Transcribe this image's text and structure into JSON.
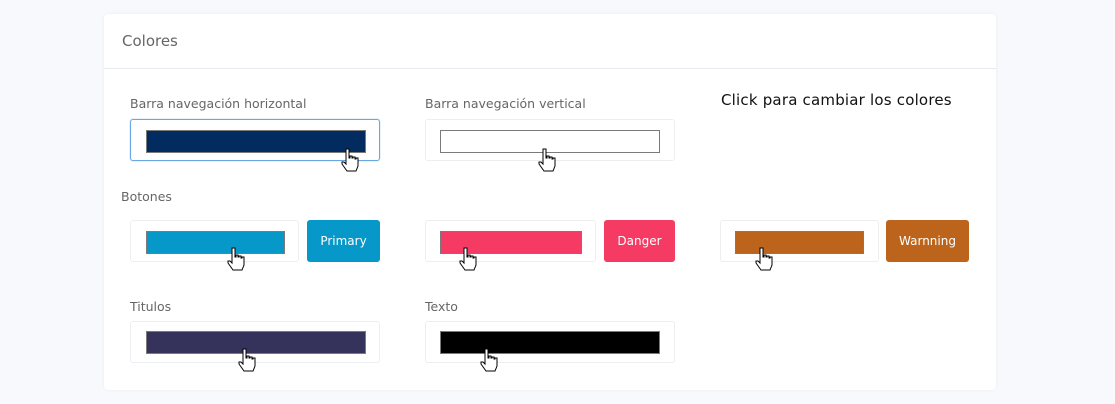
{
  "card": {
    "title": "Colores"
  },
  "hint": "Click para cambiar los colores",
  "sections": {
    "navbar_horizontal": {
      "label": "Barra navegación horizontal",
      "color": "#022c5f"
    },
    "navbar_vertical": {
      "label": "Barra navegación vertical",
      "color": "#ffffff"
    },
    "buttons": {
      "label": "Botones",
      "primary": {
        "color": "#0598c8",
        "button_label": "Primary"
      },
      "danger": {
        "color": "#f53b63",
        "button_label": "Danger"
      },
      "warning": {
        "color": "#bc641b",
        "button_label": "Warnning"
      }
    },
    "titles": {
      "label": "Titulos",
      "color": "#35335c"
    },
    "text": {
      "label": "Texto",
      "color": "#000000"
    }
  },
  "icons": {
    "cursor": "hand-pointer-icon"
  }
}
